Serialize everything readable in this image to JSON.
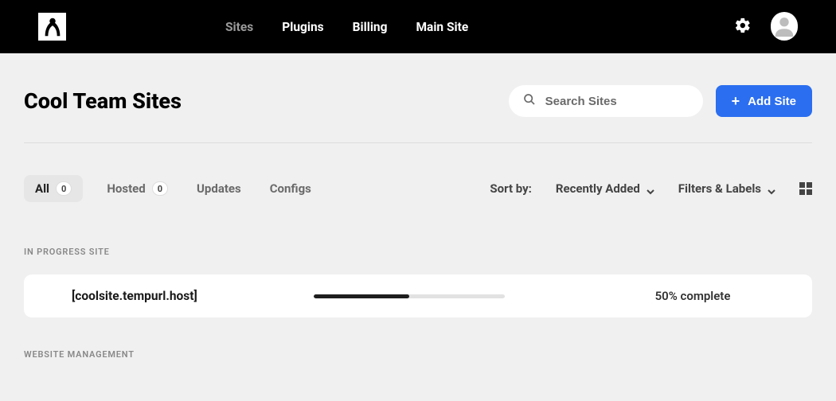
{
  "nav": {
    "sites": "Sites",
    "plugins": "Plugins",
    "billing": "Billing",
    "mainSite": "Main Site"
  },
  "page": {
    "title": "Cool Team Sites"
  },
  "search": {
    "placeholder": "Search Sites"
  },
  "addSite": {
    "label": "Add Site"
  },
  "tabs": {
    "all": {
      "label": "All",
      "count": "0"
    },
    "hosted": {
      "label": "Hosted",
      "count": "0"
    },
    "updates": {
      "label": "Updates"
    },
    "configs": {
      "label": "Configs"
    }
  },
  "sort": {
    "label": "Sort by:",
    "value": "Recently Added"
  },
  "filters": {
    "label": "Filters & Labels"
  },
  "sections": {
    "inProgress": "IN PROGRESS SITE",
    "management": "WEBSITE MANAGEMENT"
  },
  "inProgressSite": {
    "name": "[coolsite.tempurl.host]",
    "percent": 50,
    "status": "50% complete"
  }
}
